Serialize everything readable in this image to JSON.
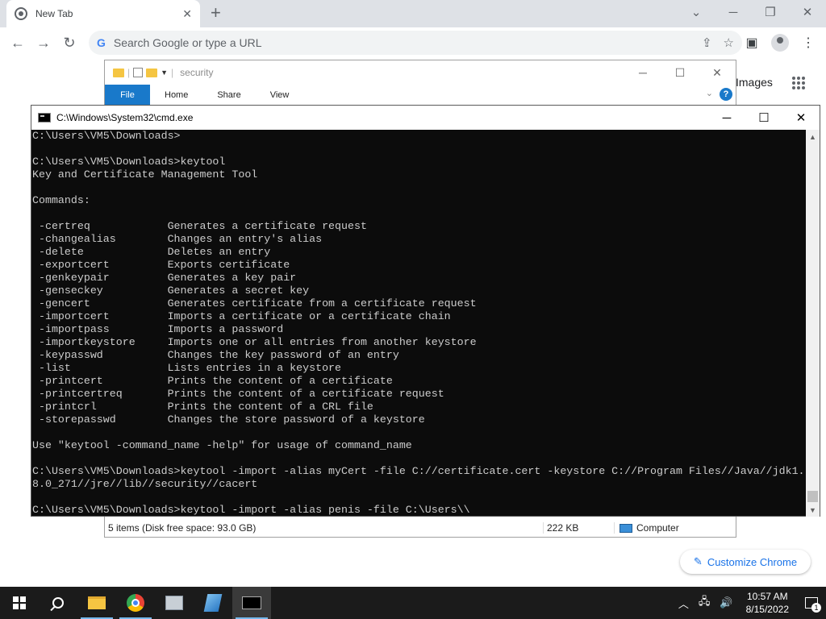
{
  "chrome": {
    "tab_title": "New Tab",
    "omnibox_placeholder": "Search Google or type a URL",
    "images_link": "Images",
    "customize_label": "Customize Chrome"
  },
  "explorer": {
    "title": "security",
    "ribbon_tabs": [
      "File",
      "Home",
      "Share",
      "View"
    ],
    "status_items": "5 items (Disk free space: 93.0 GB)",
    "status_size": "222 KB",
    "status_location": "Computer"
  },
  "cmd": {
    "title": "C:\\Windows\\System32\\cmd.exe",
    "lines": [
      "C:\\Users\\VM5\\Downloads>",
      "",
      "C:\\Users\\VM5\\Downloads>keytool",
      "Key and Certificate Management Tool",
      "",
      "Commands:",
      "",
      " -certreq            Generates a certificate request",
      " -changealias        Changes an entry's alias",
      " -delete             Deletes an entry",
      " -exportcert         Exports certificate",
      " -genkeypair         Generates a key pair",
      " -genseckey          Generates a secret key",
      " -gencert            Generates certificate from a certificate request",
      " -importcert         Imports a certificate or a certificate chain",
      " -importpass         Imports a password",
      " -importkeystore     Imports one or all entries from another keystore",
      " -keypasswd          Changes the key password of an entry",
      " -list               Lists entries in a keystore",
      " -printcert          Prints the content of a certificate",
      " -printcertreq       Prints the content of a certificate request",
      " -printcrl           Prints the content of a CRL file",
      " -storepasswd        Changes the store password of a keystore",
      "",
      "Use \"keytool -command_name -help\" for usage of command_name",
      "",
      "C:\\Users\\VM5\\Downloads>keytool -import -alias myCert -file C://certificate.cert -keystore C://Program Files//Java//jdk1.",
      "8.0_271//jre//lib//security//cacert",
      "",
      "C:\\Users\\VM5\\Downloads>keytool -import -alias penis -file C:\\Users\\\\"
    ]
  },
  "taskbar": {
    "time": "10:57 AM",
    "date": "8/15/2022",
    "notification_count": "1"
  }
}
